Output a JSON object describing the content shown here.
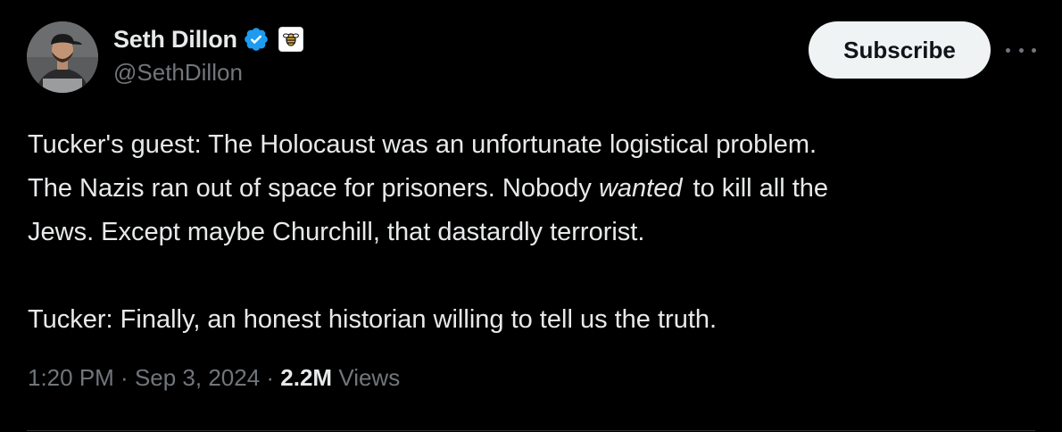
{
  "author": {
    "display_name": "Seth Dillon",
    "handle": "@SethDillon",
    "verified_icon": "verified-badge-icon",
    "affiliate_icon": "babylon-bee-badge-icon",
    "verified_color": "#1d9bf0"
  },
  "actions": {
    "subscribe_label": "Subscribe",
    "more_icon": "more-horizontal-icon"
  },
  "tweet": {
    "line1": "Tucker's guest: The Holocaust was an unfortunate logistical problem.",
    "line2_before": "The Nazis ran out of space for prisoners. Nobody ",
    "line2_emphasis": "wanted",
    "line2_after": " to kill all the",
    "line3": "Jews. Except maybe Churchill, that dastardly terrorist.",
    "line4": "Tucker: Finally, an honest historian willing to tell us the truth."
  },
  "meta": {
    "time": "1:20 PM",
    "separator": " · ",
    "date": "Sep 3, 2024",
    "views_count": "2.2M",
    "views_label": "Views"
  },
  "colors": {
    "background": "#000000",
    "text_primary": "#e7e9ea",
    "text_secondary": "#71767b",
    "button_bg": "#eff3f4"
  }
}
